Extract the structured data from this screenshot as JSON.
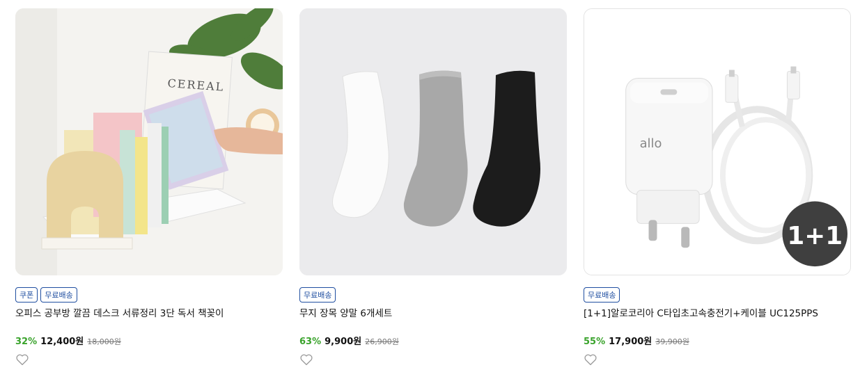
{
  "products": [
    {
      "image_alt": "",
      "badges": [
        "쿠폰",
        "무료배송"
      ],
      "title": "오피스 공부방 깔끔 데스크 서류정리 3단 독서 책꽂이",
      "discount": "32%",
      "price": "12,400원",
      "original_price": "18,000원",
      "book_label": "CEREAL"
    },
    {
      "image_alt": "",
      "badges": [
        "무료배송"
      ],
      "title": "무지 장목 양말 6개세트",
      "discount": "63%",
      "price": "9,900원",
      "original_price": "26,900원"
    },
    {
      "image_alt": "",
      "badges": [
        "무료배송"
      ],
      "title": "[1+1]알로코리아 C타입초고속충전기+케이블 UC125PPS",
      "discount": "55%",
      "price": "17,900원",
      "original_price": "39,900원",
      "brand_mark": "allo",
      "promo_badge": "1+1"
    }
  ],
  "colors": {
    "badge_border": "#1f4ea0",
    "discount": "#3aa32c"
  },
  "icons": {
    "wishlist": "heart-outline-icon"
  }
}
